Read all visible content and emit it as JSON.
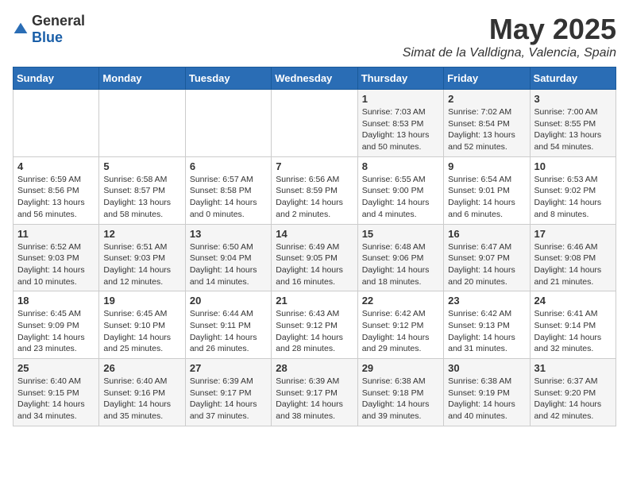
{
  "logo": {
    "general": "General",
    "blue": "Blue"
  },
  "title": "May 2025",
  "subtitle": "Simat de la Valldigna, Valencia, Spain",
  "weekdays": [
    "Sunday",
    "Monday",
    "Tuesday",
    "Wednesday",
    "Thursday",
    "Friday",
    "Saturday"
  ],
  "weeks": [
    [
      {
        "day": "",
        "info": ""
      },
      {
        "day": "",
        "info": ""
      },
      {
        "day": "",
        "info": ""
      },
      {
        "day": "",
        "info": ""
      },
      {
        "day": "1",
        "info": "Sunrise: 7:03 AM\nSunset: 8:53 PM\nDaylight: 13 hours\nand 50 minutes."
      },
      {
        "day": "2",
        "info": "Sunrise: 7:02 AM\nSunset: 8:54 PM\nDaylight: 13 hours\nand 52 minutes."
      },
      {
        "day": "3",
        "info": "Sunrise: 7:00 AM\nSunset: 8:55 PM\nDaylight: 13 hours\nand 54 minutes."
      }
    ],
    [
      {
        "day": "4",
        "info": "Sunrise: 6:59 AM\nSunset: 8:56 PM\nDaylight: 13 hours\nand 56 minutes."
      },
      {
        "day": "5",
        "info": "Sunrise: 6:58 AM\nSunset: 8:57 PM\nDaylight: 13 hours\nand 58 minutes."
      },
      {
        "day": "6",
        "info": "Sunrise: 6:57 AM\nSunset: 8:58 PM\nDaylight: 14 hours\nand 0 minutes."
      },
      {
        "day": "7",
        "info": "Sunrise: 6:56 AM\nSunset: 8:59 PM\nDaylight: 14 hours\nand 2 minutes."
      },
      {
        "day": "8",
        "info": "Sunrise: 6:55 AM\nSunset: 9:00 PM\nDaylight: 14 hours\nand 4 minutes."
      },
      {
        "day": "9",
        "info": "Sunrise: 6:54 AM\nSunset: 9:01 PM\nDaylight: 14 hours\nand 6 minutes."
      },
      {
        "day": "10",
        "info": "Sunrise: 6:53 AM\nSunset: 9:02 PM\nDaylight: 14 hours\nand 8 minutes."
      }
    ],
    [
      {
        "day": "11",
        "info": "Sunrise: 6:52 AM\nSunset: 9:03 PM\nDaylight: 14 hours\nand 10 minutes."
      },
      {
        "day": "12",
        "info": "Sunrise: 6:51 AM\nSunset: 9:03 PM\nDaylight: 14 hours\nand 12 minutes."
      },
      {
        "day": "13",
        "info": "Sunrise: 6:50 AM\nSunset: 9:04 PM\nDaylight: 14 hours\nand 14 minutes."
      },
      {
        "day": "14",
        "info": "Sunrise: 6:49 AM\nSunset: 9:05 PM\nDaylight: 14 hours\nand 16 minutes."
      },
      {
        "day": "15",
        "info": "Sunrise: 6:48 AM\nSunset: 9:06 PM\nDaylight: 14 hours\nand 18 minutes."
      },
      {
        "day": "16",
        "info": "Sunrise: 6:47 AM\nSunset: 9:07 PM\nDaylight: 14 hours\nand 20 minutes."
      },
      {
        "day": "17",
        "info": "Sunrise: 6:46 AM\nSunset: 9:08 PM\nDaylight: 14 hours\nand 21 minutes."
      }
    ],
    [
      {
        "day": "18",
        "info": "Sunrise: 6:45 AM\nSunset: 9:09 PM\nDaylight: 14 hours\nand 23 minutes."
      },
      {
        "day": "19",
        "info": "Sunrise: 6:45 AM\nSunset: 9:10 PM\nDaylight: 14 hours\nand 25 minutes."
      },
      {
        "day": "20",
        "info": "Sunrise: 6:44 AM\nSunset: 9:11 PM\nDaylight: 14 hours\nand 26 minutes."
      },
      {
        "day": "21",
        "info": "Sunrise: 6:43 AM\nSunset: 9:12 PM\nDaylight: 14 hours\nand 28 minutes."
      },
      {
        "day": "22",
        "info": "Sunrise: 6:42 AM\nSunset: 9:12 PM\nDaylight: 14 hours\nand 29 minutes."
      },
      {
        "day": "23",
        "info": "Sunrise: 6:42 AM\nSunset: 9:13 PM\nDaylight: 14 hours\nand 31 minutes."
      },
      {
        "day": "24",
        "info": "Sunrise: 6:41 AM\nSunset: 9:14 PM\nDaylight: 14 hours\nand 32 minutes."
      }
    ],
    [
      {
        "day": "25",
        "info": "Sunrise: 6:40 AM\nSunset: 9:15 PM\nDaylight: 14 hours\nand 34 minutes."
      },
      {
        "day": "26",
        "info": "Sunrise: 6:40 AM\nSunset: 9:16 PM\nDaylight: 14 hours\nand 35 minutes."
      },
      {
        "day": "27",
        "info": "Sunrise: 6:39 AM\nSunset: 9:17 PM\nDaylight: 14 hours\nand 37 minutes."
      },
      {
        "day": "28",
        "info": "Sunrise: 6:39 AM\nSunset: 9:17 PM\nDaylight: 14 hours\nand 38 minutes."
      },
      {
        "day": "29",
        "info": "Sunrise: 6:38 AM\nSunset: 9:18 PM\nDaylight: 14 hours\nand 39 minutes."
      },
      {
        "day": "30",
        "info": "Sunrise: 6:38 AM\nSunset: 9:19 PM\nDaylight: 14 hours\nand 40 minutes."
      },
      {
        "day": "31",
        "info": "Sunrise: 6:37 AM\nSunset: 9:20 PM\nDaylight: 14 hours\nand 42 minutes."
      }
    ]
  ]
}
